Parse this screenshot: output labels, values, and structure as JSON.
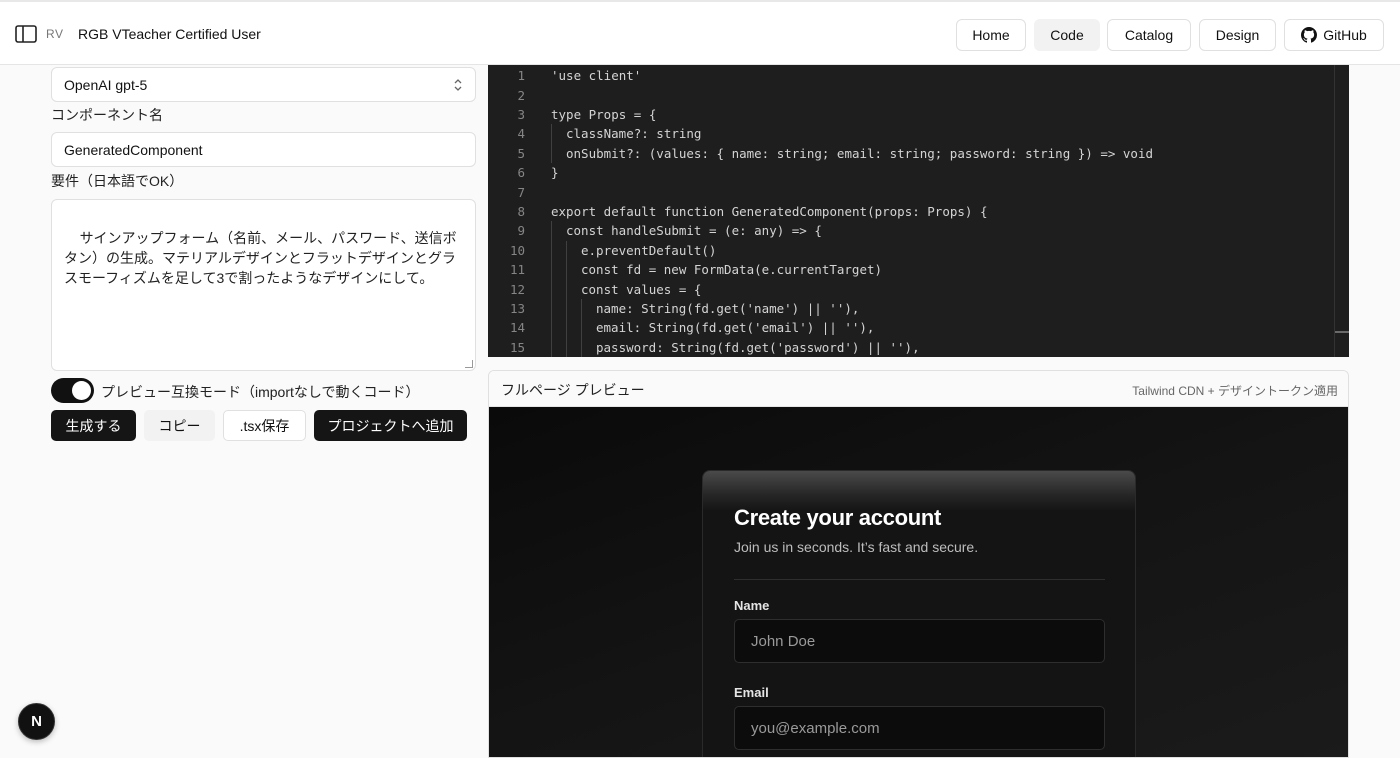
{
  "header": {
    "avatar_initials": "RV",
    "app_title": "RGB VTeacher Certified User",
    "nav": [
      {
        "label": "Home"
      },
      {
        "label": "Code",
        "active": true
      },
      {
        "label": "Catalog"
      },
      {
        "label": "Design"
      },
      {
        "label": "GitHub",
        "icon": "github-icon"
      }
    ]
  },
  "form": {
    "model_select_value": "OpenAI gpt-5",
    "component_name_label": "コンポーネント名",
    "component_name_value": "GeneratedComponent",
    "requirements_label": "要件（日本語でOK）",
    "requirements_value": "サインアップフォーム（名前、メール、パスワード、送信ボタン）の生成。マテリアルデザインとフラットデザインとグラスモーフィズムを足して3で割ったようなデザインにして。",
    "preview_mode_label": "プレビュー互換モード（importなしで動くコード）",
    "preview_mode_on": true,
    "buttons": {
      "generate": "生成する",
      "copy": "コピー",
      "save_tsx": ".tsx保存",
      "add_to_project": "プロジェクトへ追加"
    }
  },
  "code": {
    "lines": [
      {
        "n": "1",
        "indent": 0,
        "text": "'use client'"
      },
      {
        "n": "2",
        "indent": 0,
        "text": ""
      },
      {
        "n": "3",
        "indent": 0,
        "text": "type Props = {"
      },
      {
        "n": "4",
        "indent": 1,
        "text": "className?: string"
      },
      {
        "n": "5",
        "indent": 1,
        "text": "onSubmit?: (values: { name: string; email: string; password: string }) => void"
      },
      {
        "n": "6",
        "indent": 0,
        "text": "}"
      },
      {
        "n": "7",
        "indent": 0,
        "text": ""
      },
      {
        "n": "8",
        "indent": 0,
        "text": "export default function GeneratedComponent(props: Props) {"
      },
      {
        "n": "9",
        "indent": 1,
        "text": "const handleSubmit = (e: any) => {"
      },
      {
        "n": "10",
        "indent": 2,
        "text": "e.preventDefault()"
      },
      {
        "n": "11",
        "indent": 2,
        "text": "const fd = new FormData(e.currentTarget)"
      },
      {
        "n": "12",
        "indent": 2,
        "text": "const values = {"
      },
      {
        "n": "13",
        "indent": 3,
        "text": "name: String(fd.get('name') || ''),"
      },
      {
        "n": "14",
        "indent": 3,
        "text": "email: String(fd.get('email') || ''),"
      },
      {
        "n": "15",
        "indent": 3,
        "text": "password: String(fd.get('password') || ''),"
      }
    ]
  },
  "preview": {
    "title": "フルページ プレビュー",
    "note": "Tailwind CDN + デザイントークン適用",
    "card": {
      "title": "Create your account",
      "subtitle": "Join us in seconds. It’s fast and secure.",
      "name_label": "Name",
      "name_placeholder": "John Doe",
      "email_label": "Email",
      "email_placeholder": "you@example.com"
    }
  },
  "fab": {
    "label": "N"
  }
}
